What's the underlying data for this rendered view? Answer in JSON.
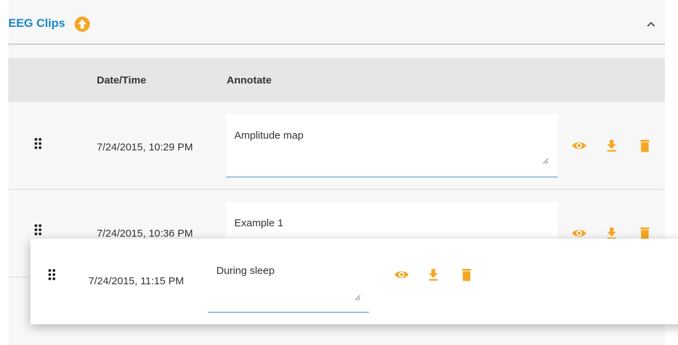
{
  "section": {
    "title": "EEG Clips"
  },
  "table": {
    "headers": {
      "datetime": "Date/Time",
      "annotate": "Annotate"
    },
    "rows": [
      {
        "datetime": "7/24/2015, 10:29 PM",
        "annotation": "Amplitude map"
      },
      {
        "datetime": "7/24/2015, 10:36 PM",
        "annotation": "Example 1"
      }
    ],
    "dragging_row": {
      "datetime": "7/24/2015, 11:15 PM",
      "annotation": "During sleep"
    }
  },
  "colors": {
    "accent": "#f5a623",
    "title": "#1a86c9",
    "underline": "#4a90d9"
  },
  "icons": {
    "info": "arrow-up-circle-icon",
    "collapse": "chevron-up-icon",
    "drag": "drag-handle-icon",
    "view": "eye-icon",
    "download": "download-icon",
    "delete": "trash-icon"
  }
}
